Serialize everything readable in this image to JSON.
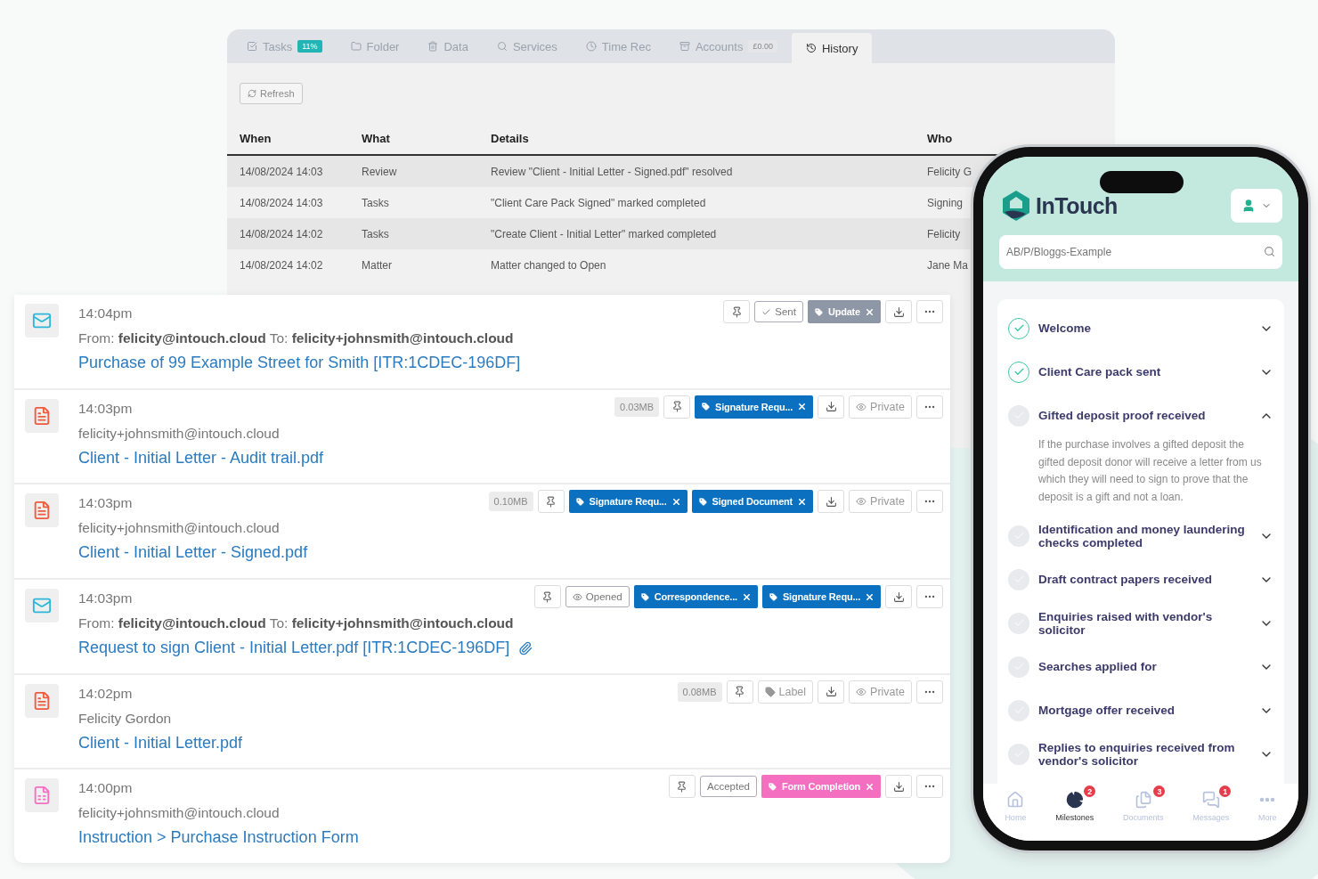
{
  "history_window": {
    "tabs": [
      {
        "label": "Tasks",
        "badge": "11%",
        "selected": false
      },
      {
        "label": "Folder",
        "selected": false
      },
      {
        "label": "Data",
        "selected": false
      },
      {
        "label": "Services",
        "selected": false
      },
      {
        "label": "Time Rec",
        "selected": false
      },
      {
        "label": "Accounts",
        "badge": "£0.00",
        "selected": false
      },
      {
        "label": "History",
        "selected": true
      }
    ],
    "refresh_button": "Refresh",
    "table": {
      "columns": [
        "When",
        "What",
        "Details",
        "Who"
      ],
      "rows": [
        [
          "14/08/2024 14:03",
          "Review",
          "Review \"Client - Initial Letter - Signed.pdf\" resolved",
          "Felicity G"
        ],
        [
          "14/08/2024 14:03",
          "Tasks",
          "\"Client Care Pack Signed\" marked completed",
          "Signing"
        ],
        [
          "14/08/2024 14:02",
          "Tasks",
          "\"Create Client - Initial Letter\" marked completed",
          "Felicity"
        ],
        [
          "14/08/2024 14:02",
          "Matter",
          "Matter changed to Open",
          "Jane Ma"
        ]
      ]
    }
  },
  "timeline": [
    {
      "kind": "email",
      "time": "14:04pm",
      "from": "From: **felicity@intouch.cloud** To: **felicity+johnsmith@intouch.cloud**",
      "title": "Purchase of 99 Example Street for Smith [ITR:1CDEC-196DF]",
      "attachment": false,
      "actions": [
        {
          "kind": "pin"
        },
        {
          "kind": "sent",
          "label": "Sent"
        },
        {
          "kind": "tag",
          "label": "Update",
          "color": "#8e97a6"
        },
        {
          "kind": "download"
        },
        {
          "kind": "more"
        }
      ]
    },
    {
      "kind": "pdf",
      "time": "14:03pm",
      "from": "felicity+johnsmith@intouch.cloud",
      "title": "Client - Initial Letter - Audit trail.pdf",
      "attachment": false,
      "actions": [
        {
          "kind": "size",
          "label": "0.03MB"
        },
        {
          "kind": "pin"
        },
        {
          "kind": "tag",
          "label": "Signature Requ...",
          "color": "#0a70bf"
        },
        {
          "kind": "download"
        },
        {
          "kind": "private",
          "label": "Private"
        },
        {
          "kind": "more"
        }
      ]
    },
    {
      "kind": "pdf",
      "time": "14:03pm",
      "from": "felicity+johnsmith@intouch.cloud",
      "title": "Client - Initial Letter - Signed.pdf",
      "attachment": false,
      "actions": [
        {
          "kind": "size",
          "label": "0.10MB"
        },
        {
          "kind": "pin"
        },
        {
          "kind": "tag",
          "label": "Signature Requ...",
          "color": "#0a70bf"
        },
        {
          "kind": "tag",
          "label": "Signed Document",
          "color": "#0a70bf"
        },
        {
          "kind": "download"
        },
        {
          "kind": "private",
          "label": "Private"
        },
        {
          "kind": "more"
        }
      ]
    },
    {
      "kind": "email",
      "time": "14:03pm",
      "from": "From: **felicity@intouch.cloud** To: **felicity+johnsmith@intouch.cloud**",
      "title": "Request to sign Client - Initial Letter.pdf [ITR:1CDEC-196DF]",
      "attachment": true,
      "actions": [
        {
          "kind": "pin"
        },
        {
          "kind": "opened",
          "label": "Opened"
        },
        {
          "kind": "tag",
          "label": "Correspondence...",
          "color": "#0a70bf"
        },
        {
          "kind": "tag",
          "label": "Signature Requ...",
          "color": "#0a70bf"
        },
        {
          "kind": "download"
        },
        {
          "kind": "more"
        }
      ]
    },
    {
      "kind": "pdf",
      "time": "14:02pm",
      "from": "Felicity Gordon",
      "title": "Client - Initial Letter.pdf",
      "attachment": false,
      "actions": [
        {
          "kind": "size",
          "label": "0.08MB"
        },
        {
          "kind": "pin"
        },
        {
          "kind": "label",
          "label": "Label"
        },
        {
          "kind": "download"
        },
        {
          "kind": "private",
          "label": "Private"
        },
        {
          "kind": "more"
        }
      ]
    },
    {
      "kind": "form",
      "time": "14:00pm",
      "from": "felicity+johnsmith@intouch.cloud",
      "title": "Instruction > Purchase Instruction Form",
      "attachment": false,
      "actions": [
        {
          "kind": "pin"
        },
        {
          "kind": "status",
          "label": "Accepted"
        },
        {
          "kind": "tag",
          "label": "Form Completion",
          "color": "#f56fc0"
        },
        {
          "kind": "download"
        },
        {
          "kind": "more"
        }
      ]
    }
  ],
  "phone": {
    "logo": "InTouch",
    "search": {
      "placeholder": "AB/P/Bloggs-Example"
    },
    "milestones": [
      {
        "title": "Welcome",
        "done": true,
        "expanded": false
      },
      {
        "title": "Client Care pack sent",
        "done": true,
        "expanded": false
      },
      {
        "title": "Gifted deposit proof received",
        "done": false,
        "expanded": true,
        "description": "If the purchase involves a gifted deposit the gifted deposit donor will receive a letter from us which they will need to sign to prove that the deposit is a gift and not a loan."
      },
      {
        "title": "Identification and money laundering checks completed",
        "done": false,
        "expanded": false
      },
      {
        "title": "Draft contract papers received",
        "done": false,
        "expanded": false
      },
      {
        "title": "Enquiries raised with vendor's solicitor",
        "done": false,
        "expanded": false
      },
      {
        "title": "Searches applied for",
        "done": false,
        "expanded": false
      },
      {
        "title": "Mortgage offer received",
        "done": false,
        "expanded": false
      },
      {
        "title": "Replies to enquiries received from vendor's solicitor",
        "done": false,
        "expanded": false
      }
    ],
    "nav": [
      {
        "label": "Home",
        "selected": false
      },
      {
        "label": "Milestones",
        "badge": "2",
        "selected": true
      },
      {
        "label": "Documents",
        "badge": "3",
        "selected": false
      },
      {
        "label": "Messages",
        "badge": "1",
        "selected": false
      },
      {
        "label": "More",
        "selected": false
      }
    ]
  }
}
